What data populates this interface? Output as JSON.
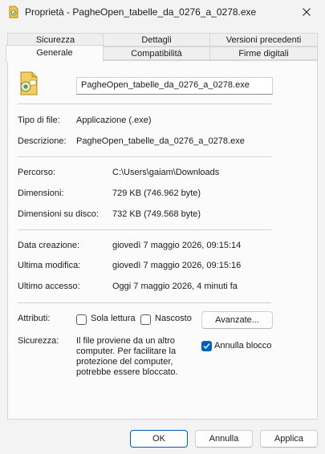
{
  "window": {
    "title": "Proprietà - PagheOpen_tabelle_da_0276_a_0278.exe"
  },
  "tabs_row1": [
    "Sicurezza",
    "Dettagli",
    "Versioni precedenti"
  ],
  "tabs_row2": [
    "Generale",
    "Compatibilità",
    "Firme digitali"
  ],
  "active_tab": "Generale",
  "file_name": "PagheOpen_tabelle_da_0276_a_0278.exe",
  "info1": [
    {
      "label": "Tipo di file:",
      "value": "Applicazione (.exe)"
    },
    {
      "label": "Descrizione:",
      "value": "PagheOpen_tabelle_da_0276_a_0278.exe"
    }
  ],
  "info2": [
    {
      "label": "Percorso:",
      "value": "C:\\Users\\gaiam\\Downloads"
    },
    {
      "label": "Dimensioni:",
      "value": "729 KB (746.962 byte)"
    },
    {
      "label": "Dimensioni su disco:",
      "value": "732 KB (749.568 byte)"
    }
  ],
  "info3": [
    {
      "label": "Data creazione:",
      "value": "giovedì 7 maggio 2026, 09:15:14"
    },
    {
      "label": "Ultima modifica:",
      "value": "giovedì 7 maggio 2026, 09:15:16"
    },
    {
      "label": "Ultimo accesso:",
      "value": "Oggi 7 maggio 2026, 4 minuti fa"
    }
  ],
  "attributes": {
    "label": "Attributi:",
    "readonly_label": "Sola lettura",
    "readonly_checked": false,
    "hidden_label": "Nascosto",
    "hidden_checked": false,
    "advanced_label": "Avanzate..."
  },
  "security": {
    "label": "Sicurezza:",
    "text": "Il file proviene da un altro computer. Per facilitare la protezione del computer, potrebbe essere bloccato.",
    "unblock_label": "Annulla blocco",
    "unblock_checked": true
  },
  "buttons": {
    "ok": "OK",
    "cancel": "Annulla",
    "apply": "Applica"
  }
}
